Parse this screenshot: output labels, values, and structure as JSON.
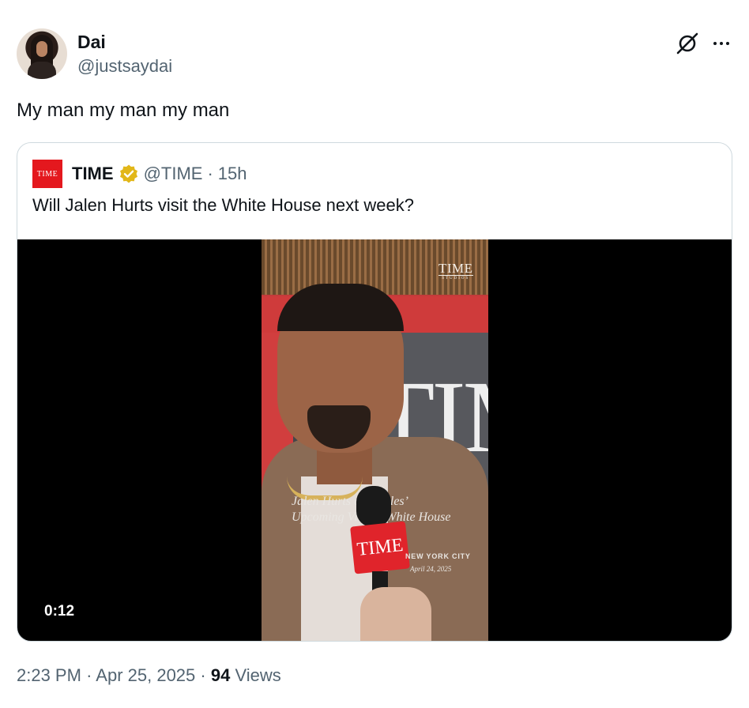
{
  "author": {
    "name": "Dai",
    "handle": "@justsaydai"
  },
  "icons": {
    "grok": "grok-icon",
    "more": "more-icon",
    "verified": "verified-icon"
  },
  "tweet": {
    "text": "My man my man my man"
  },
  "quoted": {
    "logo_text": "TIME",
    "name": "TIME",
    "handle": "@TIME",
    "separator": "·",
    "age": "15h",
    "text": "Will Jalen Hurts visit the White House next week?",
    "video": {
      "duration": "0:12",
      "brand": "TIME",
      "brand_sub": "STUDIOS",
      "backdrop_text": "TIM",
      "overlay_caption": "Jalen Hurts on Eagles’ Upcoming Visit to White House",
      "mic_flag": "TIME",
      "city": "NEW YORK CITY",
      "date": "April 24, 2025"
    }
  },
  "footer": {
    "time": "2:23 PM",
    "sep1": "·",
    "date": "Apr 25, 2025",
    "sep2": "·",
    "views_count": "94",
    "views_label": "Views"
  },
  "colors": {
    "text_primary": "#0f1419",
    "text_secondary": "#536471",
    "border": "#cfd9de",
    "verified_gold": "#e2b719",
    "time_red": "#e4181e"
  }
}
